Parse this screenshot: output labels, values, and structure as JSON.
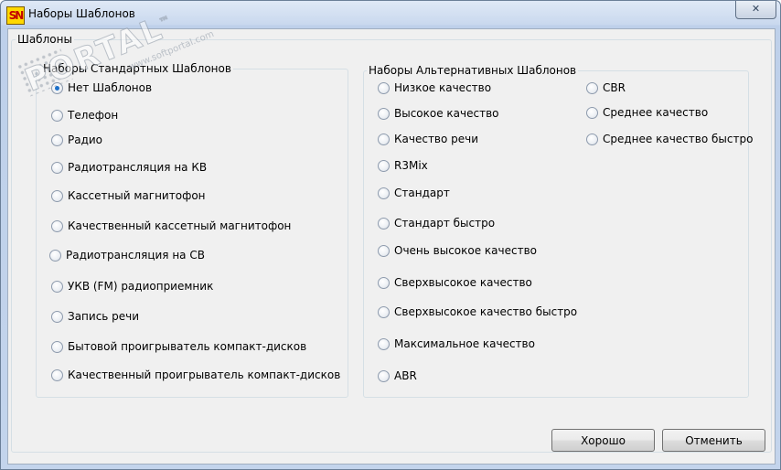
{
  "window": {
    "title": "Наборы Шаблонов",
    "icon": "sn-app-icon",
    "close_glyph": "✕"
  },
  "main_group": {
    "title": "Шаблоны"
  },
  "standard": {
    "title": "Наборы Стандартных Шаблонов",
    "selected_index": 0,
    "items": [
      "Нет Шаблонов",
      "Телефон",
      "Радио",
      "Радиотрансляция на КВ",
      "Кассетный магнитофон",
      "Качественный кассетный магнитофон",
      "Радиотрансляция на СВ",
      "УКВ (FM) радиоприемник",
      "Запись речи",
      "Бытовой проигрыватель компакт-дисков",
      "Качественный проигрыватель компакт-дисков"
    ]
  },
  "alternative": {
    "title": "Наборы Альтернативных Шаблонов",
    "col1": [
      "Низкое качество",
      "Высокое качество",
      "Качество речи",
      "R3Mix",
      "Стандарт",
      "Стандарт быстро",
      "Очень высокое качество",
      "Сверхвысокое качество",
      "Сверхвысокое качество быстро",
      "Максимальное качество",
      "ABR"
    ],
    "col2": [
      "CBR",
      "Среднее качество",
      "Среднее качество быстро"
    ]
  },
  "buttons": {
    "ok": "Хорошо",
    "cancel": "Отменить"
  },
  "watermark": {
    "main": "PORTAL",
    "tm": "™",
    "sub": "www.softportal.com"
  },
  "colors": {
    "radio_dot": "#1b6fc9",
    "client_bg": "#f0f0f0",
    "title_gradient_top": "#dfe9f6"
  }
}
